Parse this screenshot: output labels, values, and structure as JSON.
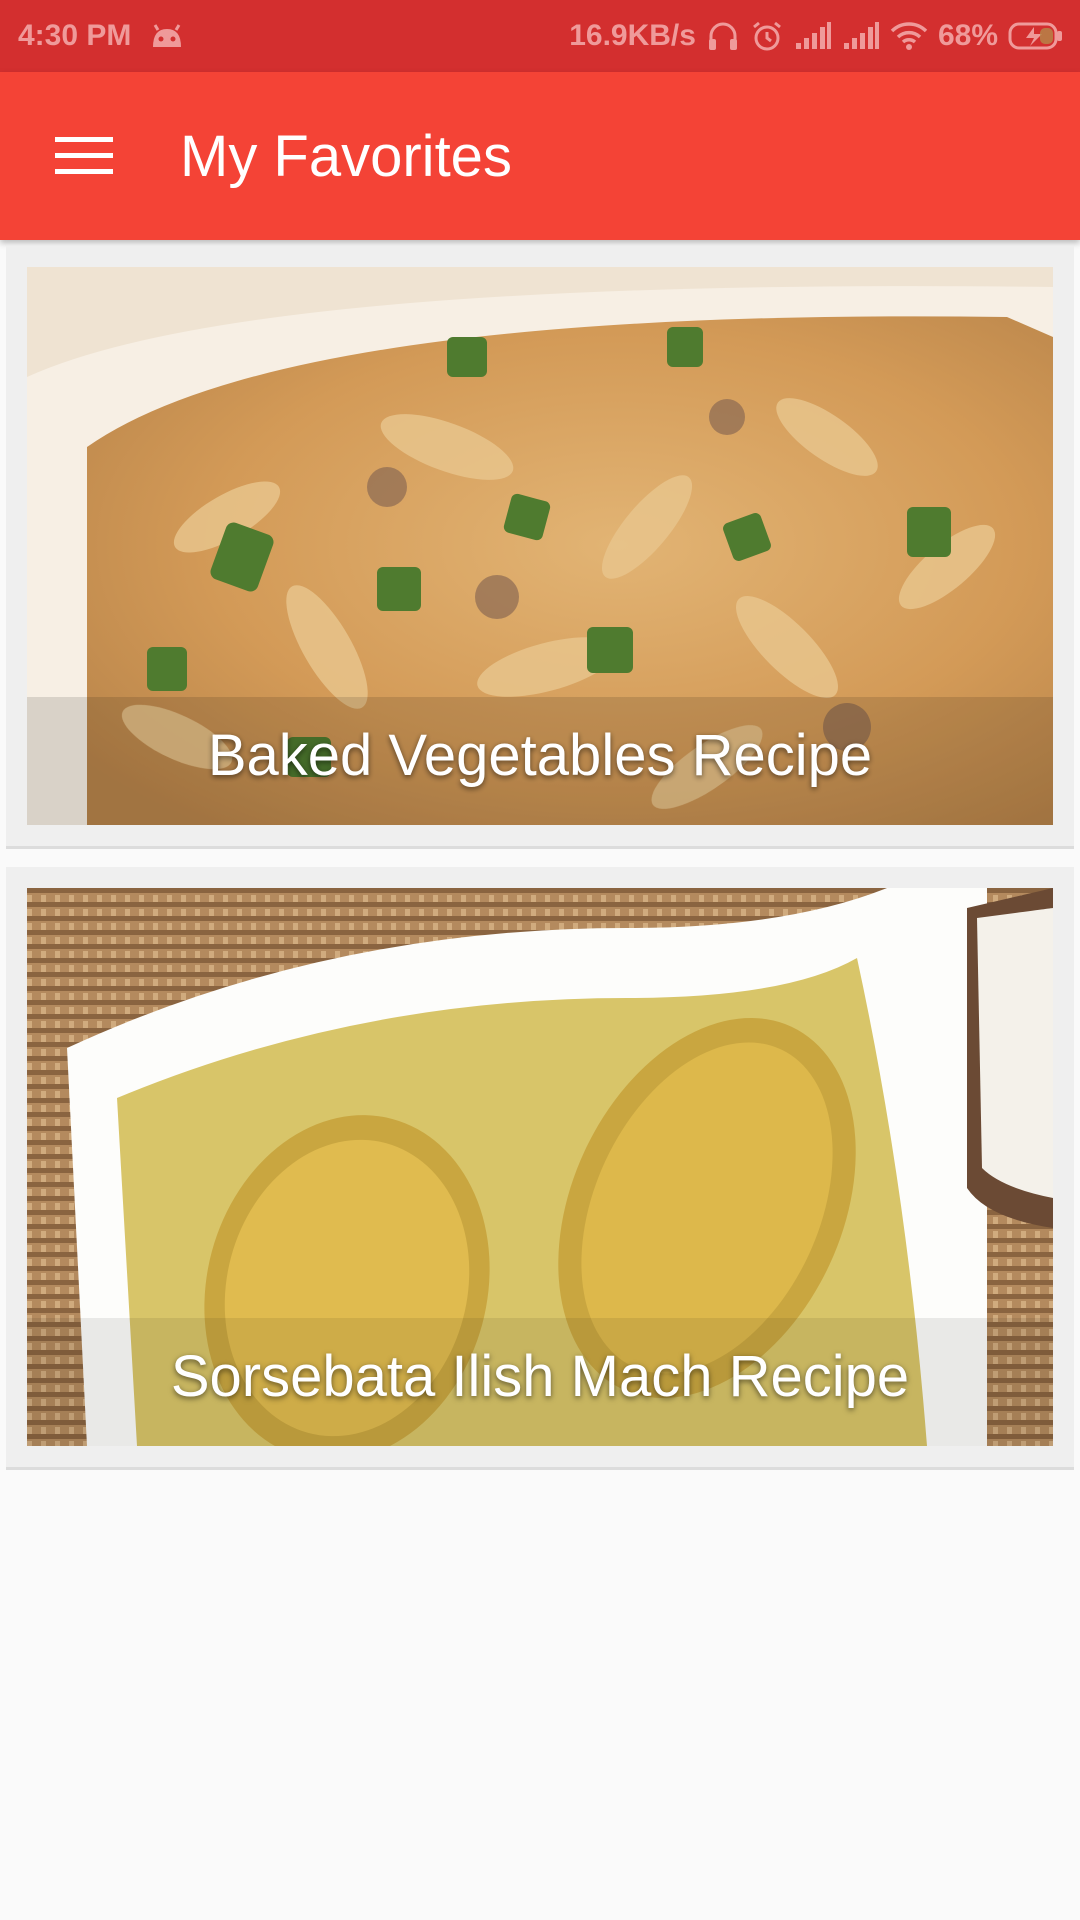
{
  "status_bar": {
    "time": "4:30 PM",
    "network_speed": "16.9KB/s",
    "battery": "68%",
    "icons": [
      "android-icon",
      "headset-icon",
      "alarm-icon",
      "signal-icon",
      "signal-icon",
      "wifi-icon",
      "battery-charging-icon"
    ]
  },
  "app_bar": {
    "title": "My Favorites",
    "menu_icon": "hamburger-menu-icon",
    "color": "#f44336"
  },
  "favorites": [
    {
      "title": "Baked Vegetables Recipe"
    },
    {
      "title": "Sorsebata Ilish Mach Recipe"
    }
  ]
}
